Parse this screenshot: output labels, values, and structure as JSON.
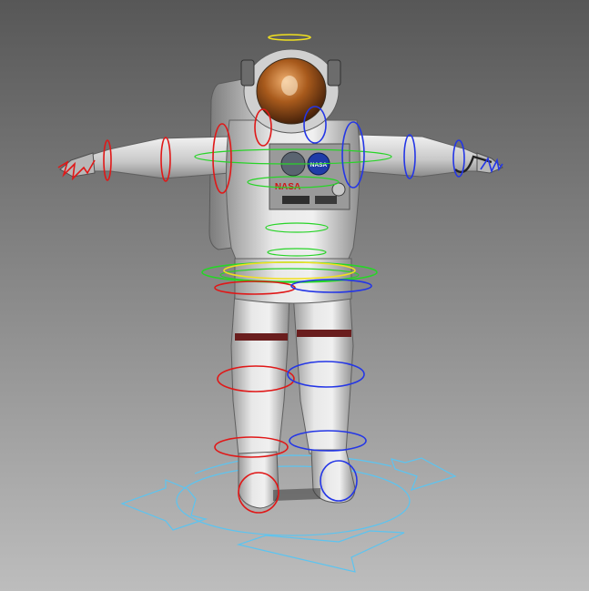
{
  "viewport": {
    "background_top": "#575757",
    "background_bottom": "#bdbdbd"
  },
  "colors": {
    "left_controls": "#e01818",
    "right_controls": "#2436e6",
    "center_controls": "#28d428",
    "head_control": "#f0e020",
    "root_control": "#5cc4f0",
    "suit": "#d8d8d8",
    "visor": "#b86a28"
  },
  "patches": {
    "nasa_chest": "NASA",
    "nasa_meatball": "NASA"
  }
}
